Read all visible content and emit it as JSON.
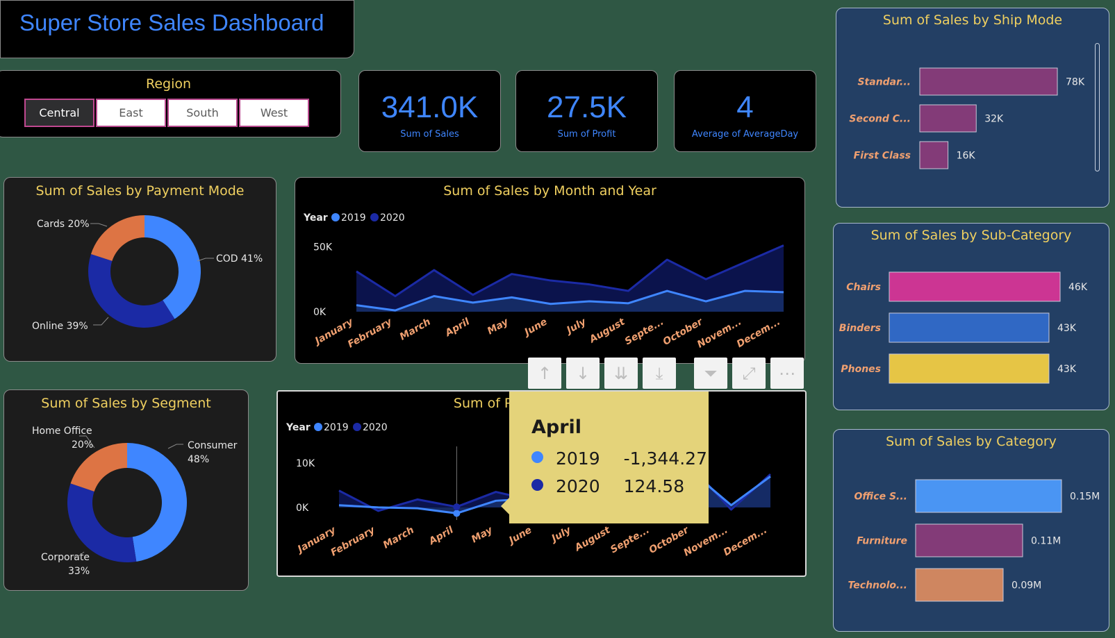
{
  "header": {
    "title": "Super Store Sales  Dashboard"
  },
  "region_slicer": {
    "label": "Region",
    "options": [
      "Central",
      "East",
      "South",
      "West"
    ],
    "selected": "Central"
  },
  "kpis": [
    {
      "value": "341.0K",
      "label": "Sum of Sales"
    },
    {
      "value": "27.5K",
      "label": "Sum of Profit"
    },
    {
      "value": "4",
      "label": "Average of AverageDay"
    }
  ],
  "colors": {
    "accent_blue": "#3f86ff",
    "navy": "#1b2aa5",
    "orange": "#dd7444",
    "magenta": "#cc3593",
    "purple": "#833b78",
    "yellow": "#e6c545",
    "salmon": "#cf8660",
    "title_yellow": "#f0d060"
  },
  "toolbar": {
    "icons": [
      "arrow-up-icon",
      "arrow-down-icon",
      "double-arrow-down-icon",
      "expand-hierarchy-icon",
      "filter-icon",
      "focus-mode-icon",
      "more-options-icon"
    ]
  },
  "tooltip": {
    "title": "April",
    "rows": [
      {
        "year": "2019",
        "value": "-1,344.27"
      },
      {
        "year": "2020",
        "value": "124.58"
      }
    ]
  },
  "chart_data": [
    {
      "id": "payment",
      "type": "pie",
      "title": "Sum of Sales by Payment Mode",
      "categories": [
        "COD",
        "Online",
        "Cards"
      ],
      "values": [
        41,
        39,
        20
      ],
      "labels": [
        "COD 41%",
        "Online 39%",
        "Cards 20%"
      ],
      "colors": [
        "#3f86ff",
        "#1b2aa5",
        "#dd7444"
      ]
    },
    {
      "id": "segment",
      "type": "pie",
      "title": "Sum of Sales by Segment",
      "categories": [
        "Consumer",
        "Corporate",
        "Home Office"
      ],
      "values": [
        48,
        33,
        20
      ],
      "labels": [
        [
          "Consumer",
          "48%"
        ],
        [
          "Corporate",
          "33%"
        ],
        [
          "Home Office",
          "20%"
        ]
      ],
      "colors": [
        "#3f86ff",
        "#1b2aa5",
        "#dd7444"
      ]
    },
    {
      "id": "sales_month",
      "type": "area",
      "title": "Sum of Sales by Month and Year",
      "legend_title": "Year",
      "categories": [
        "January",
        "February",
        "March",
        "April",
        "May",
        "June",
        "July",
        "August",
        "Septe...",
        "October",
        "Novem...",
        "Decem..."
      ],
      "series": [
        {
          "name": "2019",
          "color": "#3f86ff",
          "values": [
            5000,
            1000,
            12000,
            7000,
            11000,
            6000,
            8000,
            6500,
            16000,
            8000,
            16000,
            15000
          ]
        },
        {
          "name": "2020",
          "color": "#1b2aa5",
          "values": [
            31000,
            12000,
            32000,
            13000,
            29000,
            24000,
            21000,
            16000,
            40000,
            25000,
            38000,
            51000
          ]
        }
      ],
      "yticks": [
        "0K",
        "50K"
      ],
      "ylim": [
        0,
        55000
      ]
    },
    {
      "id": "profit_month",
      "type": "area",
      "title": "Sum of Pro",
      "legend_title": "Year",
      "categories": [
        "January",
        "February",
        "March",
        "April",
        "May",
        "June",
        "July",
        "August",
        "Septe...",
        "October",
        "Novem...",
        "Decem..."
      ],
      "series": [
        {
          "name": "2019",
          "color": "#3f86ff",
          "values": [
            500,
            0,
            -200,
            -1344.27,
            1500,
            2000,
            1500,
            2500,
            3000,
            8000,
            500,
            7000
          ]
        },
        {
          "name": "2020",
          "color": "#1b2aa5",
          "values": [
            3800,
            -800,
            1800,
            124.58,
            3500,
            1500,
            2500,
            3000,
            4000,
            9000,
            -500,
            7500
          ]
        }
      ],
      "yticks": [
        "0K",
        "10K"
      ],
      "ylim": [
        -3000,
        13000
      ]
    },
    {
      "id": "shipmode",
      "type": "bar",
      "title": "Sum of Sales by Ship Mode",
      "categories": [
        "Standar...",
        "Second C...",
        "First Class"
      ],
      "values": [
        78000,
        32000,
        16000
      ],
      "labels": [
        "78K",
        "32K",
        "16K"
      ],
      "colors": [
        "#833b78",
        "#833b78",
        "#833b78"
      ],
      "xmax": 78000
    },
    {
      "id": "subcat",
      "type": "bar",
      "title": "Sum of Sales by Sub-Category",
      "categories": [
        "Chairs",
        "Binders",
        "Phones"
      ],
      "values": [
        46000,
        43000,
        43000
      ],
      "labels": [
        "46K",
        "43K",
        "43K"
      ],
      "colors": [
        "#cc3593",
        "#3068c4",
        "#e6c545"
      ],
      "xmax": 46000
    },
    {
      "id": "category",
      "type": "bar",
      "title": "Sum of Sales by Category",
      "categories": [
        "Office S...",
        "Furniture",
        "Technolo..."
      ],
      "values": [
        150000,
        110000,
        90000
      ],
      "labels": [
        "0.15M",
        "0.11M",
        "0.09M"
      ],
      "colors": [
        "#4a95f3",
        "#833b78",
        "#cf8660"
      ],
      "xmax": 150000
    }
  ]
}
